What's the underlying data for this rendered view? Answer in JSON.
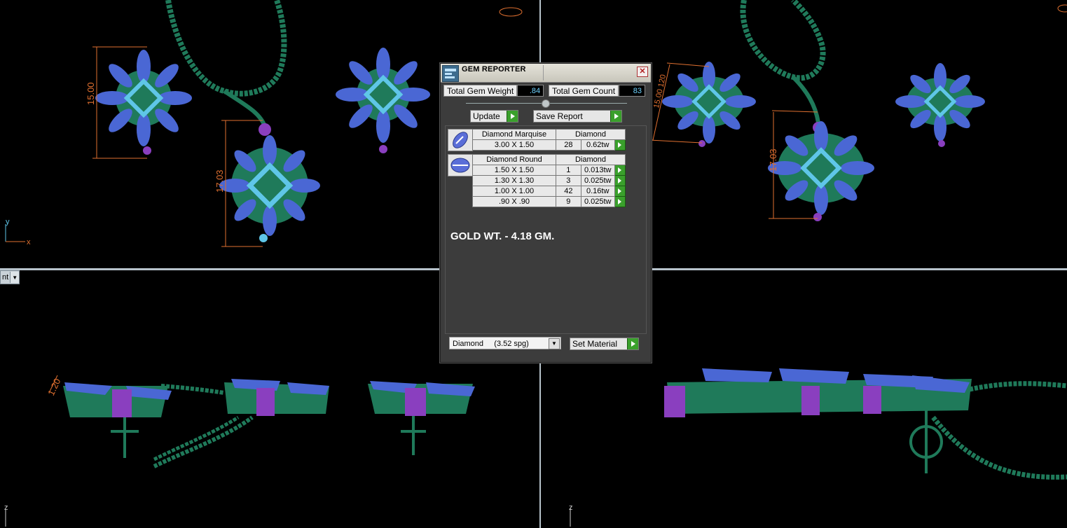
{
  "viewports": {
    "top_left": {
      "dim_vertical_1": "15.00",
      "dim_vertical_2": "17.03",
      "axis_y": "y",
      "axis_x": "x"
    },
    "top_right": {
      "dim_angled": "15.00 120",
      "dim_vertical": "17.03"
    },
    "bottom_left": {
      "dim_small": "1.20",
      "axis_z": "z",
      "menu_label": "nt"
    },
    "bottom_right": {
      "axis_z": "z"
    }
  },
  "gem_reporter": {
    "title": "GEM REPORTER",
    "close_symbol": "✕",
    "total_gem_weight_label": "Total Gem Weight",
    "total_gem_weight_value": ".84",
    "total_gem_count_label": "Total Gem Count",
    "total_gem_count_value": "83",
    "update_label": "Update",
    "save_report_label": "Save Report",
    "groups": [
      {
        "name": "Diamond Marquise",
        "material": "Diamond",
        "rows": [
          {
            "size": "3.00 X 1.50",
            "count": "28",
            "weight": "0.62tw"
          }
        ]
      },
      {
        "name": "Diamond Round",
        "material": "Diamond",
        "rows": [
          {
            "size": "1.50 X 1.50",
            "count": "1",
            "weight": "0.013tw"
          },
          {
            "size": "1.30 X 1.30",
            "count": "3",
            "weight": "0.025tw"
          },
          {
            "size": "1.00 X 1.00",
            "count": "42",
            "weight": "0.16tw"
          },
          {
            "size": ".90 X .90",
            "count": "9",
            "weight": "0.025tw"
          }
        ]
      }
    ],
    "note": "GOLD WT. - 4.18 GM.",
    "material_select_value": "Diamond     (3.52 spg)",
    "set_material_label": "Set Material"
  },
  "colors": {
    "metal": "#1f7a5a",
    "gem_blue": "#4a67d4",
    "gem_light": "#5fc6e8",
    "prong": "#8a3fbf",
    "dimension": "#e07030",
    "go_button": "#3aa02c"
  }
}
